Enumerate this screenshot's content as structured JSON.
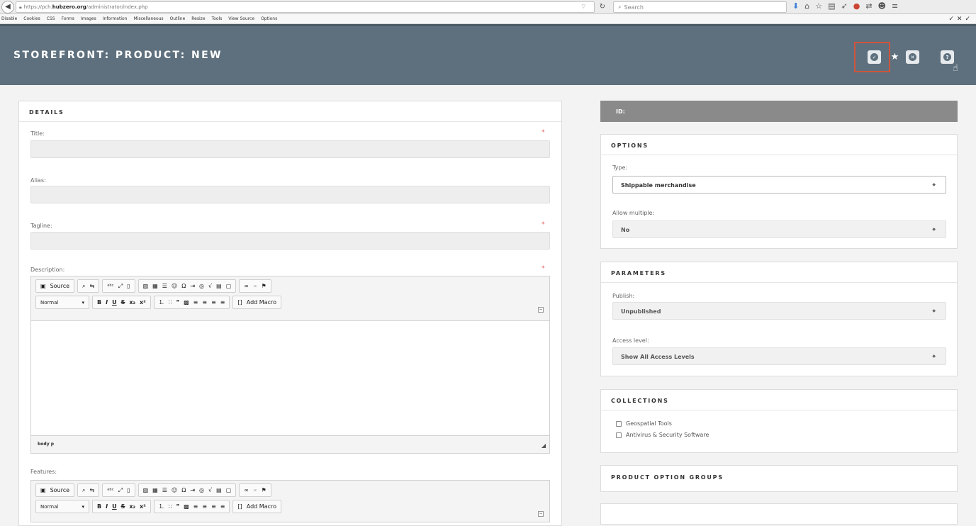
{
  "browser": {
    "url_prefix": "https://pch.",
    "url_host": "hubzero.org",
    "url_path": "/administrator/index.php",
    "search_placeholder": "Search"
  },
  "devbar": {
    "items": [
      "Disable",
      "Cookies",
      "CSS",
      "Forms",
      "Images",
      "Information",
      "Miscellaneous",
      "Outline",
      "Resize",
      "Tools",
      "View Source",
      "Options"
    ]
  },
  "header": {
    "title": "STOREFRONT: PRODUCT: NEW"
  },
  "details": {
    "heading": "DETAILS",
    "title_label": "Title:",
    "alias_label": "Alias:",
    "tagline_label": "Tagline:",
    "description_label": "Description:",
    "features_label": "Features:",
    "required_mark": "*"
  },
  "editor": {
    "source_label": "Source",
    "format_label": "Normal",
    "add_macro_label": "Add Macro",
    "path": "body  p"
  },
  "sidebar": {
    "id_label": "ID:",
    "options": {
      "heading": "OPTIONS",
      "type_label": "Type:",
      "type_value": "Shippable merchandise",
      "multiple_label": "Allow multiple:",
      "multiple_value": "No"
    },
    "parameters": {
      "heading": "PARAMETERS",
      "publish_label": "Publish:",
      "publish_value": "Unpublished",
      "access_label": "Access level:",
      "access_value": "Show All Access Levels"
    },
    "collections": {
      "heading": "COLLECTIONS",
      "items": [
        "Geospatial Tools",
        "Antivirus & Security Software"
      ]
    },
    "option_groups": {
      "heading": "PRODUCT OPTION GROUPS"
    }
  },
  "colors": {
    "header_bg": "#5e707e",
    "highlight": "#d0543b",
    "required": "#e35b5b"
  }
}
